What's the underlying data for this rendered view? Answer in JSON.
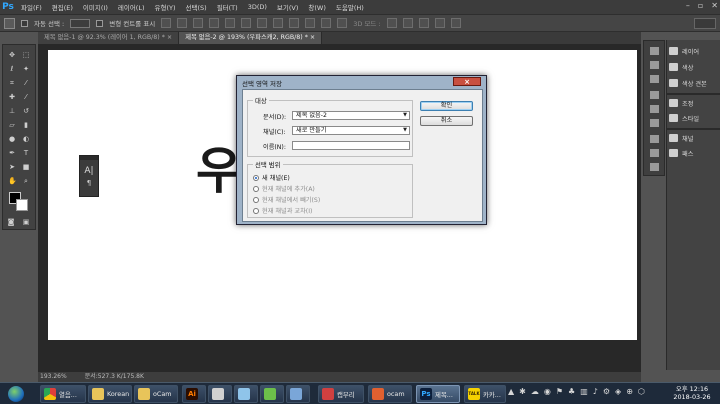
{
  "app": {
    "logo": "Ps"
  },
  "menu": [
    "파일(F)",
    "편집(E)",
    "이미지(I)",
    "레이어(L)",
    "유형(Y)",
    "선택(S)",
    "필터(T)",
    "3D(D)",
    "보기(V)",
    "창(W)",
    "도움말(H)"
  ],
  "options_bar": {
    "auto_select": "자동 선택 :",
    "transform_controls": "변형 컨트롤 표시",
    "mode_3d": "3D 모드 :"
  },
  "tabs": [
    {
      "label": "제목 없음-1 @ 92.3% (레이어 1, RGB/8) *  ×",
      "active": false
    },
    {
      "label": "제목 없음-2 @ 193% (우파스캐2, RGB/8) *  ×",
      "active": true
    }
  ],
  "canvas_text": "우",
  "char_panel": {
    "glyph_a": "A|",
    "glyph_p": "¶"
  },
  "status": {
    "zoom": "193.26%",
    "doc": "문서:527.3 K/175.8K"
  },
  "right_panels": {
    "group1": [
      "레이어",
      "색상",
      "색상 견본"
    ],
    "group2": [
      "조정",
      "스타일"
    ],
    "group3": [
      "채널",
      "패스"
    ]
  },
  "dialog": {
    "title": "선택 영역 저장",
    "close_label": "×",
    "target_group": "대상",
    "document_label": "문서(D):",
    "document_value": "제목 없음-2",
    "channel_label": "채널(C):",
    "channel_value": "새로 만들기",
    "name_label": "이름(N):",
    "name_value": "",
    "operation_group": "선택 범위",
    "radios": [
      {
        "label": "새 채널(E)",
        "checked": true,
        "enabled": true
      },
      {
        "label": "현재 채널에 추가(A)",
        "checked": false,
        "enabled": false
      },
      {
        "label": "현재 채널에서 빼기(S)",
        "checked": false,
        "enabled": false
      },
      {
        "label": "현재 채널과 교차(I)",
        "checked": false,
        "enabled": false
      }
    ],
    "ok_label": "확인",
    "cancel_label": "취소"
  },
  "taskbar": {
    "items": [
      {
        "label": "열음...",
        "icon": "chrome-icon",
        "color": "#e0a020"
      },
      {
        "label": "Korean",
        "icon": "folder-icon",
        "color": "#e8c45a"
      },
      {
        "label": "oCam",
        "icon": "folder-icon",
        "color": "#e8c45a"
      },
      {
        "label": "",
        "icon": "illustrator-icon",
        "color": "#ff7c00",
        "glyph": "Ai"
      },
      {
        "label": "",
        "icon": "pen-icon",
        "color": "#d0d0d0"
      },
      {
        "label": "",
        "icon": "notepad-icon",
        "color": "#8fc4ea"
      },
      {
        "label": "",
        "icon": "evernote-icon",
        "color": "#6cbf4a"
      },
      {
        "label": "",
        "icon": "explorer-icon",
        "color": "#7aa6d8"
      },
      {
        "label": "캡무리",
        "icon": "capture-icon",
        "color": "#d04040"
      },
      {
        "label": "ocam",
        "icon": "ocam-icon",
        "color": "#e06030"
      },
      {
        "label": "제목...",
        "icon": "photoshop-icon",
        "color": "#1a3a6a",
        "glyph": "Ps"
      },
      {
        "label": "카카...",
        "icon": "kakaotalk-icon",
        "color": "#f5d200",
        "glyph": "TALK"
      }
    ],
    "clock_time": "오후 12:16",
    "clock_date": "2018-03-26"
  }
}
